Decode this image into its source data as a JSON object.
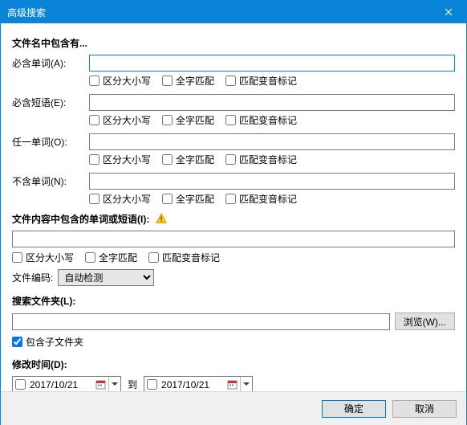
{
  "window": {
    "title": "高级搜索"
  },
  "filename_section": {
    "heading": "文件名中包含有...",
    "required_words": {
      "label": "必含单词(A):"
    },
    "required_phrases": {
      "label": "必含短语(E):"
    },
    "any_words": {
      "label": "任一单词(O):"
    },
    "exclude_words": {
      "label": "不含单词(N):"
    },
    "opts": {
      "case": "区分大小写",
      "whole": "全字匹配",
      "diacritics": "匹配变音标记"
    }
  },
  "content_section": {
    "heading": "文件内容中包含的单词或短语(I):",
    "opts": {
      "case": "区分大小写",
      "whole": "全字匹配",
      "diacritics": "匹配变音标记"
    },
    "encoding_label": "文件编码:",
    "encoding_value": "自动检测"
  },
  "folder_section": {
    "heading": "搜索文件夹(L):",
    "browse": "浏览(W)...",
    "subfolders": "包含子文件夹"
  },
  "date_section": {
    "heading": "修改时间(D):",
    "from": "2017/10/21",
    "to_label": "到",
    "to": "2017/10/21"
  },
  "buttons": {
    "ok": "确定",
    "cancel": "取消"
  }
}
